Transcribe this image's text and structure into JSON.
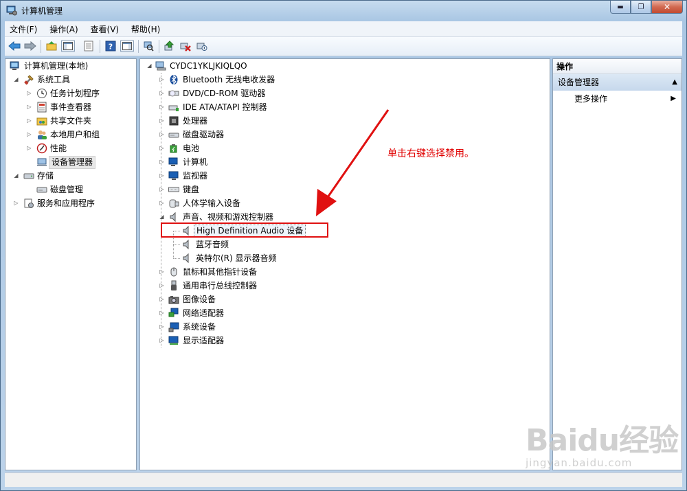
{
  "window": {
    "title": "计算机管理",
    "controls": {
      "minimize": "▬",
      "maximize": "❐",
      "close": "✕"
    }
  },
  "menu": [
    "文件(F)",
    "操作(A)",
    "查看(V)",
    "帮助(H)"
  ],
  "left_tree": {
    "root": "计算机管理(本地)",
    "system_tools": "系统工具",
    "task_scheduler": "任务计划程序",
    "event_viewer": "事件查看器",
    "shared_folders": "共享文件夹",
    "local_users": "本地用户和组",
    "performance": "性能",
    "device_manager": "设备管理器",
    "storage": "存储",
    "disk_management": "磁盘管理",
    "services_apps": "服务和应用程序"
  },
  "device_tree": {
    "computer": "CYDC1YKLJKIQLQO",
    "categories": [
      "Bluetooth 无线电收发器",
      "DVD/CD-ROM 驱动器",
      "IDE ATA/ATAPI 控制器",
      "处理器",
      "磁盘驱动器",
      "电池",
      "计算机",
      "监视器",
      "键盘",
      "人体学输入设备",
      "声音、视频和游戏控制器",
      "鼠标和其他指针设备",
      "通用串行总线控制器",
      "图像设备",
      "网络适配器",
      "系统设备",
      "显示适配器"
    ],
    "sound_children": [
      "High Definition Audio 设备",
      "蓝牙音频",
      "英特尔(R) 显示器音频"
    ]
  },
  "annotation": "单击右键选择禁用。",
  "actions": {
    "header": "操作",
    "section": "设备管理器",
    "more": "更多操作"
  },
  "watermark": {
    "main": "Baidu经验",
    "sub": "jingyan.baidu.com"
  },
  "colors": {
    "annotation_red": "#e00000",
    "highlight_box": "#e01010"
  }
}
